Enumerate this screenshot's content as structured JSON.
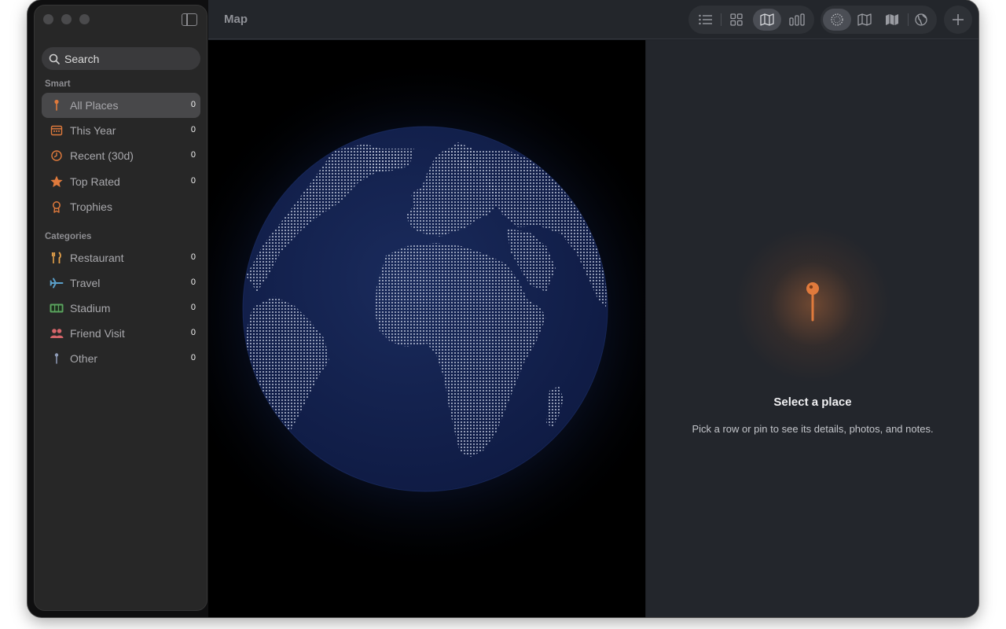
{
  "window": {
    "title": "Map"
  },
  "sidebar": {
    "search_placeholder": "Search",
    "sections": [
      {
        "header": "Smart",
        "items": [
          {
            "label": "All Places",
            "count": "0",
            "icon": "pin-icon",
            "selected": true
          },
          {
            "label": "This Year",
            "count": "0",
            "icon": "calendar-icon"
          },
          {
            "label": "Recent (30d)",
            "count": "0",
            "icon": "clock-icon"
          },
          {
            "label": "Top Rated",
            "count": "0",
            "icon": "star-icon"
          },
          {
            "label": "Trophies",
            "icon": "award-icon"
          }
        ]
      },
      {
        "header": "Categories",
        "items": [
          {
            "label": "Restaurant",
            "count": "0",
            "icon": "fork-knife-icon"
          },
          {
            "label": "Travel",
            "count": "0",
            "icon": "airplane-icon"
          },
          {
            "label": "Stadium",
            "count": "0",
            "icon": "scoreboard-icon"
          },
          {
            "label": "Friend Visit",
            "count": "0",
            "icon": "people-icon"
          },
          {
            "label": "Other",
            "count": "0",
            "icon": "pin-icon"
          }
        ]
      }
    ]
  },
  "toolbar": {
    "view_modes": [
      "list-icon",
      "grid-icon",
      "map-icon",
      "chart-icon"
    ],
    "active_view": "map-icon",
    "map_styles": [
      "globe-dots-icon",
      "map-outline-icon",
      "map-filled-icon",
      "earth-icon"
    ],
    "active_style": "globe-dots-icon",
    "add": "plus-icon"
  },
  "detail": {
    "title": "Select a place",
    "subtitle": "Pick a row or pin to see its details, photos, and notes.",
    "icon": "pin-icon"
  },
  "colors": {
    "accent": "#e07a3c",
    "sidebar_bg": "#272727",
    "selected_row": "#48484a",
    "globe": "#14224a",
    "dot": "#c5cde0"
  }
}
